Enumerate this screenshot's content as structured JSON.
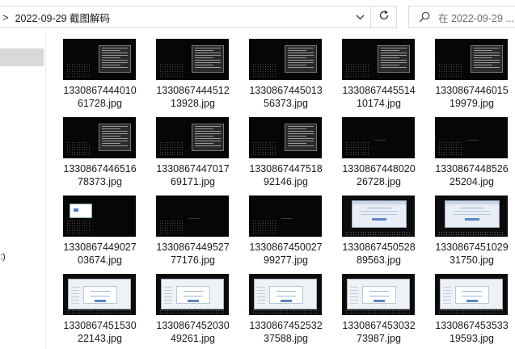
{
  "address": {
    "separator": ">",
    "path": "2022-09-29 截图解码"
  },
  "search": {
    "placeholder": "在 2022-09-29 ..."
  },
  "nav": {
    "partial_label": ":)"
  },
  "files": [
    {
      "name_line1": "1330867444010",
      "name_line2": "61728.jpg",
      "thumb": "terminal"
    },
    {
      "name_line1": "1330867444512",
      "name_line2": "13928.jpg",
      "thumb": "terminal"
    },
    {
      "name_line1": "1330867445013",
      "name_line2": "56373.jpg",
      "thumb": "terminal"
    },
    {
      "name_line1": "1330867445514",
      "name_line2": "10174.jpg",
      "thumb": "terminal"
    },
    {
      "name_line1": "1330867446015",
      "name_line2": "19979.jpg",
      "thumb": "terminal"
    },
    {
      "name_line1": "1330867446516",
      "name_line2": "78373.jpg",
      "thumb": "terminal"
    },
    {
      "name_line1": "1330867447017",
      "name_line2": "69171.jpg",
      "thumb": "terminal"
    },
    {
      "name_line1": "1330867447518",
      "name_line2": "92146.jpg",
      "thumb": "terminal"
    },
    {
      "name_line1": "1330867448020",
      "name_line2": "26728.jpg",
      "thumb": "dark"
    },
    {
      "name_line1": "1330867448526",
      "name_line2": "25204.jpg",
      "thumb": "dark"
    },
    {
      "name_line1": "1330867449027",
      "name_line2": "03674.jpg",
      "thumb": "small-window"
    },
    {
      "name_line1": "1330867449527",
      "name_line2": "77176.jpg",
      "thumb": "dark"
    },
    {
      "name_line1": "1330867450027",
      "name_line2": "99277.jpg",
      "thumb": "dark"
    },
    {
      "name_line1": "1330867450528",
      "name_line2": "89563.jpg",
      "thumb": "dialog"
    },
    {
      "name_line1": "1330867451029",
      "name_line2": "31750.jpg",
      "thumb": "dialog"
    },
    {
      "name_line1": "1330867451530",
      "name_line2": "22143.jpg",
      "thumb": "dialog-wide"
    },
    {
      "name_line1": "1330867452030",
      "name_line2": "49261.jpg",
      "thumb": "dialog-wide"
    },
    {
      "name_line1": "1330867452532",
      "name_line2": "37588.jpg",
      "thumb": "dialog-wide"
    },
    {
      "name_line1": "1330867453032",
      "name_line2": "73987.jpg",
      "thumb": "dialog-wide"
    },
    {
      "name_line1": "1330867453533",
      "name_line2": "19593.jpg",
      "thumb": "dialog-wide"
    }
  ]
}
